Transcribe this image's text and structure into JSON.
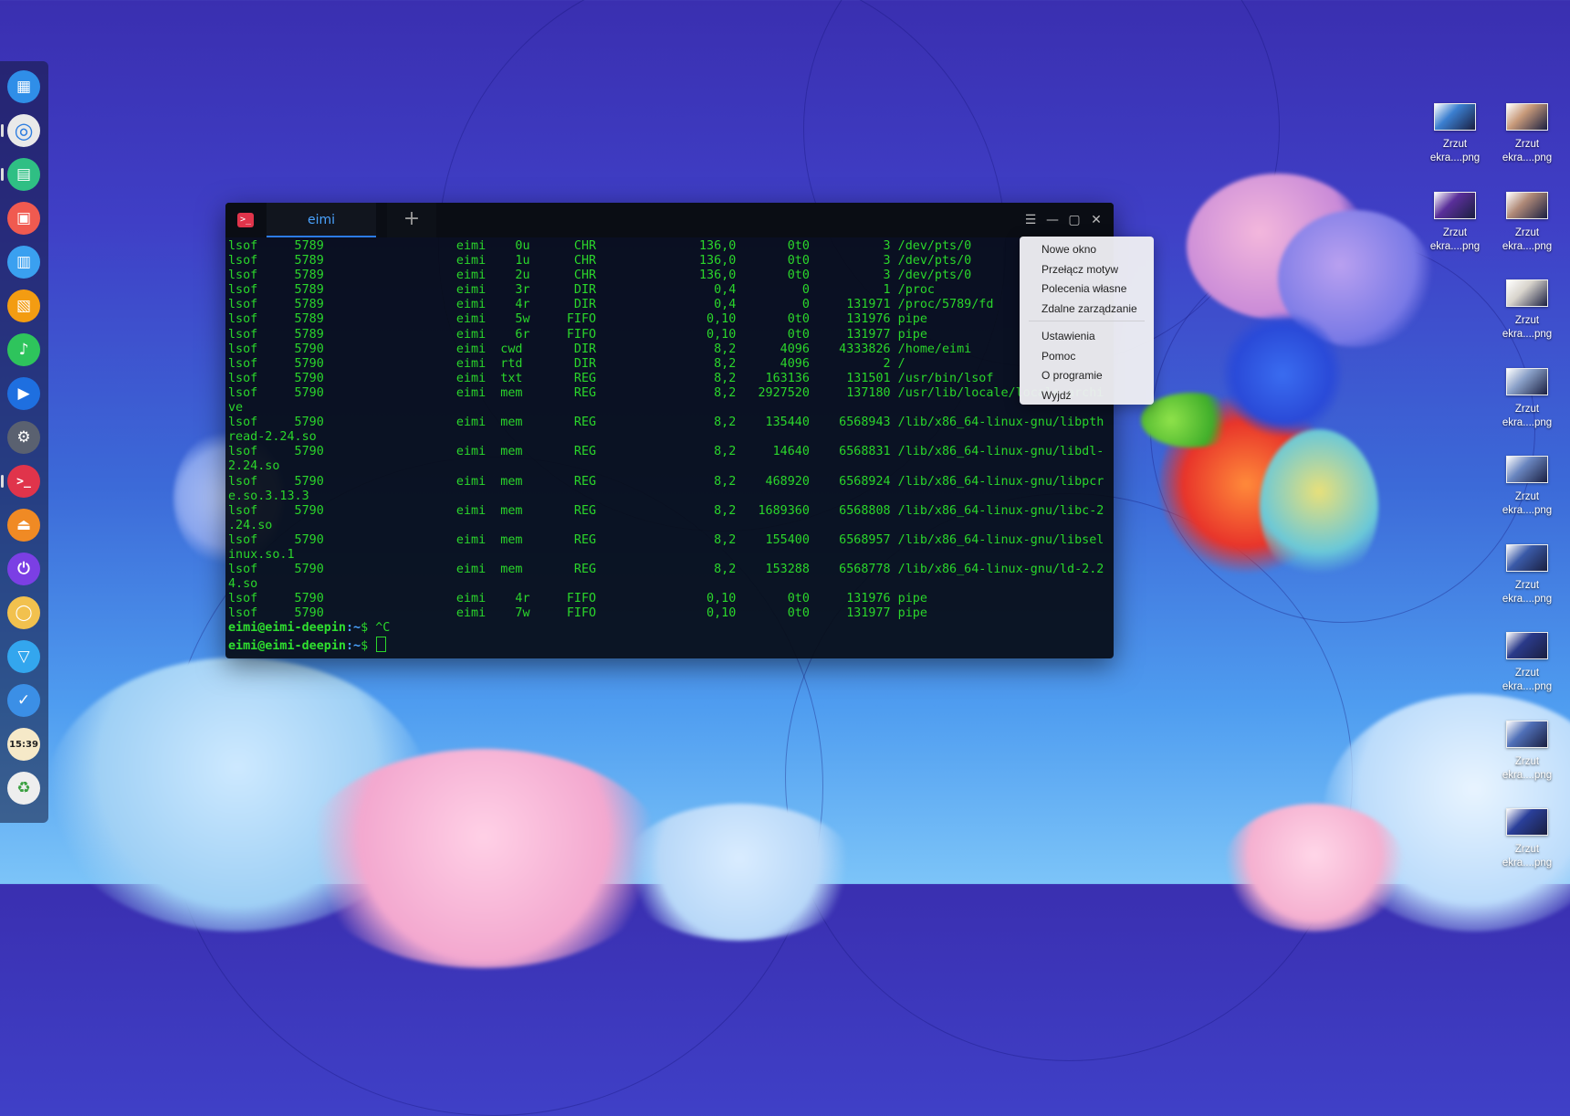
{
  "dock": {
    "items": [
      {
        "name": "launcher-icon",
        "bg": "#2f8ee8",
        "glyph": "▦"
      },
      {
        "name": "chrome-icon",
        "bg": "#e9e9e9",
        "glyph": "◎"
      },
      {
        "name": "deepin-files-icon",
        "bg": "#2fbf84",
        "glyph": "▤"
      },
      {
        "name": "screen-recorder-icon",
        "bg": "#f05a50",
        "glyph": "▣"
      },
      {
        "name": "app-store-icon",
        "bg": "#3aa0f0",
        "glyph": "▥"
      },
      {
        "name": "store-icon",
        "bg": "#f39c12",
        "glyph": "▧"
      },
      {
        "name": "music-icon",
        "bg": "#2ec45c",
        "glyph": "♪"
      },
      {
        "name": "movie-icon",
        "bg": "#1e6fe0",
        "glyph": "▶"
      },
      {
        "name": "settings-icon",
        "bg": "#5a6170",
        "glyph": "⚙"
      },
      {
        "name": "terminal-icon",
        "bg": "#e0344b",
        "glyph": ">_"
      },
      {
        "name": "eject-icon",
        "bg": "#f08a24",
        "glyph": "⏏"
      },
      {
        "name": "power-icon",
        "bg": "#7b3fe4",
        "glyph": "⏻"
      },
      {
        "name": "deepin-icon",
        "bg": "#f2c14e",
        "glyph": "◯"
      },
      {
        "name": "wifi-icon",
        "bg": "#33a6ee",
        "glyph": "▽"
      },
      {
        "name": "task-manager-icon",
        "bg": "#3b8fe6",
        "glyph": "✓"
      },
      {
        "name": "clock-icon",
        "bg": "#f6e9c8",
        "glyph": ""
      },
      {
        "name": "trash-icon",
        "bg": "#eeeeee",
        "glyph": "♻"
      }
    ],
    "clock_text": "15:39"
  },
  "terminal": {
    "tab_label": "eimi",
    "add_tab_glyph": "+",
    "window_buttons": {
      "menu": "☰",
      "minimize": "—",
      "maximize": "▢",
      "close": "✕"
    },
    "lines": [
      "lsof     5789                  eimi    0u      CHR              136,0       0t0          3 /dev/pts/0",
      "lsof     5789                  eimi    1u      CHR              136,0       0t0          3 /dev/pts/0",
      "lsof     5789                  eimi    2u      CHR              136,0       0t0          3 /dev/pts/0",
      "lsof     5789                  eimi    3r      DIR                0,4         0          1 /proc",
      "lsof     5789                  eimi    4r      DIR                0,4         0     131971 /proc/5789/fd",
      "lsof     5789                  eimi    5w     FIFO               0,10       0t0     131976 pipe",
      "lsof     5789                  eimi    6r     FIFO               0,10       0t0     131977 pipe",
      "lsof     5790                  eimi  cwd       DIR                8,2      4096    4333826 /home/eimi",
      "lsof     5790                  eimi  rtd       DIR                8,2      4096          2 /",
      "lsof     5790                  eimi  txt       REG                8,2    163136     131501 /usr/bin/lsof",
      "lsof     5790                  eimi  mem       REG                8,2   2927520     137180 /usr/lib/locale/locale-archi",
      "ve",
      "lsof     5790                  eimi  mem       REG                8,2    135440    6568943 /lib/x86_64-linux-gnu/libpth",
      "read-2.24.so",
      "lsof     5790                  eimi  mem       REG                8,2     14640    6568831 /lib/x86_64-linux-gnu/libdl-",
      "2.24.so",
      "lsof     5790                  eimi  mem       REG                8,2    468920    6568924 /lib/x86_64-linux-gnu/libpcr",
      "e.so.3.13.3",
      "lsof     5790                  eimi  mem       REG                8,2   1689360    6568808 /lib/x86_64-linux-gnu/libc-2",
      ".24.so",
      "lsof     5790                  eimi  mem       REG                8,2    155400    6568957 /lib/x86_64-linux-gnu/libsel",
      "inux.so.1",
      "lsof     5790                  eimi  mem       REG                8,2    153288    6568778 /lib/x86_64-linux-gnu/ld-2.2",
      "4.so",
      "lsof     5790                  eimi    4r     FIFO               0,10       0t0     131976 pipe",
      "lsof     5790                  eimi    7w     FIFO               0,10       0t0     131977 pipe"
    ],
    "prompts": [
      {
        "user": "eimi@eimi-deepin",
        "path": ":~",
        "symbol": "$ ",
        "input": "^C"
      },
      {
        "user": "eimi@eimi-deepin",
        "path": ":~",
        "symbol": "$ ",
        "input": ""
      }
    ]
  },
  "menu": {
    "group1": [
      "Nowe okno",
      "Przełącz motyw",
      "Polecenia własne",
      "Zdalne zarządzanie"
    ],
    "group2": [
      "Ustawienia",
      "Pomoc",
      "O programie",
      "Wyjdź"
    ]
  },
  "desktop": {
    "col1": [
      {
        "line1": "Zrzut",
        "line2": "ekra....png",
        "thumb": "#3b7fd0"
      },
      {
        "line1": "Zrzut",
        "line2": "ekra....png",
        "thumb": "#5a2f9a"
      }
    ],
    "col2": [
      {
        "line1": "Zrzut",
        "line2": "ekra....png",
        "thumb": "#c89a7a"
      },
      {
        "line1": "Zrzut",
        "line2": "ekra....png",
        "thumb": "#b08a78"
      },
      {
        "line1": "Zrzut",
        "line2": "ekra....png",
        "thumb": "#d8d4cc"
      },
      {
        "line1": "Zrzut",
        "line2": "ekra....png",
        "thumb": "#8aa0c8"
      },
      {
        "line1": "Zrzut",
        "line2": "ekra....png",
        "thumb": "#6a86c0"
      },
      {
        "line1": "Zrzut",
        "line2": "ekra....png",
        "thumb": "#3a5aa8"
      },
      {
        "line1": "Zrzut",
        "line2": "ekra....png",
        "thumb": "#2a3a8a"
      },
      {
        "line1": "Zrzut",
        "line2": "ekra....png",
        "thumb": "#5070b8"
      },
      {
        "line1": "Zrzut",
        "line2": "ekra....png",
        "thumb": "#2a3f9a"
      }
    ]
  },
  "colors": {
    "accent": "#2c7be5",
    "terminal_text": "#2bd62b",
    "terminal_bg": "#060c16"
  }
}
